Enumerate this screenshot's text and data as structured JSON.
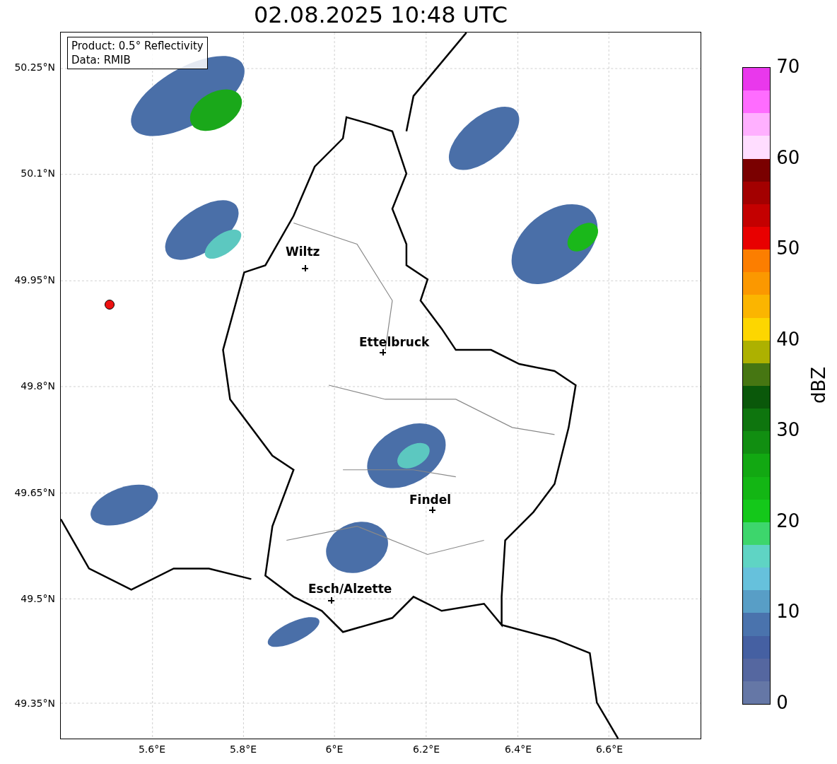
{
  "title": "02.08.2025 10:48 UTC",
  "info_box": [
    "Product: 0.5° Reflectivity",
    "Data: RMIB"
  ],
  "map": {
    "y_ticks": [
      "50.25°N",
      "50.1°N",
      "49.95°N",
      "49.8°N",
      "49.65°N",
      "49.5°N",
      "49.35°N"
    ],
    "x_ticks": [
      "5.6°E",
      "5.8°E",
      "6°E",
      "6.2°E",
      "6.4°E",
      "6.6°E"
    ],
    "places": [
      {
        "name": "Wiltz"
      },
      {
        "name": "Ettelbruck"
      },
      {
        "name": "Findel"
      },
      {
        "name": "Esch/Alzette"
      }
    ],
    "radar_site": {
      "color": "#ee1111"
    }
  },
  "colorbar": {
    "label": "dBZ",
    "ticks": [
      "70",
      "60",
      "50",
      "40",
      "30",
      "20",
      "10",
      "0"
    ],
    "segments": [
      {
        "color": "#e938ec"
      },
      {
        "color": "#ff6cff"
      },
      {
        "color": "#ffb0ff"
      },
      {
        "color": "#ffddff"
      },
      {
        "color": "#7a0000"
      },
      {
        "color": "#a30000"
      },
      {
        "color": "#c40000"
      },
      {
        "color": "#e80000"
      },
      {
        "color": "#fc7e00"
      },
      {
        "color": "#fb9800"
      },
      {
        "color": "#fbb500"
      },
      {
        "color": "#fdd600"
      },
      {
        "color": "#adb100"
      },
      {
        "color": "#467612"
      },
      {
        "color": "#0a580a"
      },
      {
        "color": "#0e750e"
      },
      {
        "color": "#118e11"
      },
      {
        "color": "#12a812"
      },
      {
        "color": "#13b614"
      },
      {
        "color": "#14c81a"
      },
      {
        "color": "#3dd66c"
      },
      {
        "color": "#5fd4c4"
      },
      {
        "color": "#66c1dc"
      },
      {
        "color": "#589ec6"
      },
      {
        "color": "#4a73ad"
      },
      {
        "color": "#4560a2"
      },
      {
        "color": "#5567a0"
      },
      {
        "color": "#6577a6"
      }
    ]
  }
}
